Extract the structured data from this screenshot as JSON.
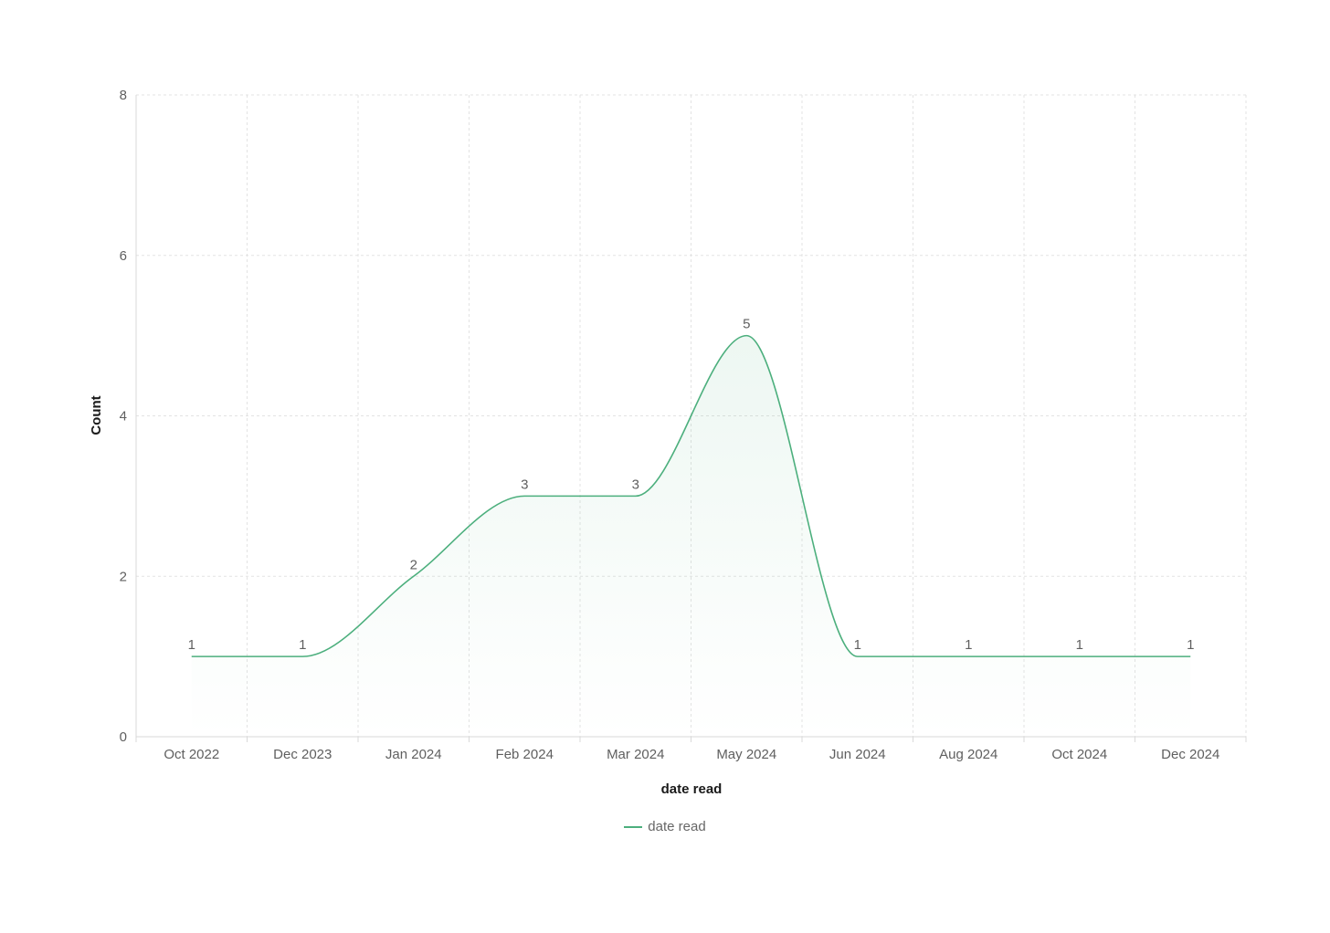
{
  "chart_data": {
    "type": "area",
    "xlabel": "date read",
    "ylabel": "Count",
    "categories": [
      "Oct 2022",
      "Dec 2023",
      "Jan 2024",
      "Feb 2024",
      "Mar 2024",
      "May 2024",
      "Jun 2024",
      "Aug 2024",
      "Oct 2024",
      "Dec 2024"
    ],
    "series": [
      {
        "name": "date read",
        "values": [
          1,
          1,
          2,
          3,
          3,
          5,
          1,
          1,
          1,
          1
        ],
        "color": "#4caf7d"
      }
    ],
    "ylim": [
      0,
      8
    ],
    "yticks": [
      0,
      2,
      4,
      6,
      8
    ],
    "grid": true,
    "curve": "smooth",
    "data_labels": true,
    "legend_position": "bottom-center"
  }
}
